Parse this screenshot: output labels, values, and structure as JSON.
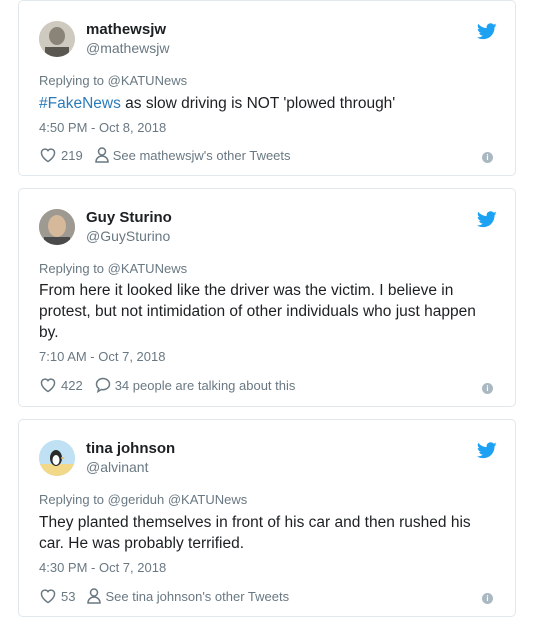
{
  "tweets": [
    {
      "name": "mathewsjw",
      "handle": "@mathewsjw",
      "reply_prefix": "Replying to",
      "reply_to": "@KATUNews",
      "hashtag": "#FakeNews",
      "text": " as slow driving is NOT 'plowed through'",
      "time": "4:50 PM - Oct 8, 2018",
      "likes": "219",
      "action_text": "See mathewsjw's other Tweets",
      "action_icon": "person-icon"
    },
    {
      "name": "Guy Sturino",
      "handle": "@GuySturino",
      "reply_prefix": "Replying to",
      "reply_to": "@KATUNews",
      "text": "From here it looked like the driver was the victim. I believe in protest,  but not intimidation of other individuals who just happen by.",
      "time": "7:10 AM - Oct 7, 2018",
      "likes": "422",
      "action_text": "34 people are talking about this",
      "action_icon": "comment-icon"
    },
    {
      "name": "tina johnson",
      "handle": "@alvinant",
      "reply_prefix": "Replying to",
      "reply_to": "@geriduh @KATUNews",
      "text": "They planted themselves in front of his car and then rushed his car. He was probably terrified.",
      "time": "4:30 PM - Oct 7, 2018",
      "likes": "53",
      "action_text": "See tina johnson's other Tweets",
      "action_icon": "person-icon"
    }
  ],
  "colors": {
    "link": "#2b7bb9",
    "twitter_blue": "#1da1f2",
    "muted": "#697882",
    "border": "#e1e8ed"
  }
}
